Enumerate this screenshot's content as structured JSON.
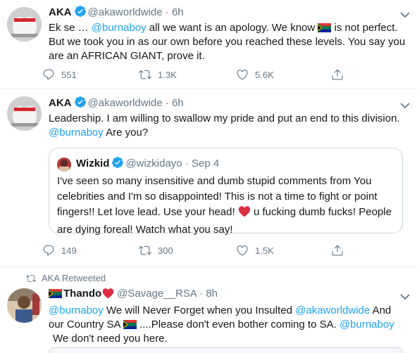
{
  "tweets": [
    {
      "name": "AKA",
      "handle": "@akaworldwide",
      "dot": "·",
      "time": "6h",
      "text_parts": [
        "Ek se … ",
        "@burnaboy",
        " all we want is an apology. We know ",
        " is not perfect.",
        "But we took you in as our own before you reached these levels. You say you",
        "are an AFRICAN GIANT, prove it."
      ],
      "replies": "551",
      "retweets": "1.3K",
      "likes": "5.6K"
    },
    {
      "name": "AKA",
      "handle": "@akaworldwide",
      "dot": "·",
      "time": "6h",
      "text_parts": [
        "Leadership. I am willing to swallow my pride and put an end to this division.",
        "@burnaboy",
        " Are you?"
      ],
      "quote": {
        "name": "Wizkid",
        "handle": "@wizkidayo",
        "dot": "·",
        "time": "Sep 4",
        "lines": [
          "I've seen so many insensitive and dumb stupid comments from You",
          "celebrities and I'm so disappointed! This is not a time to fight or point",
          "fingers!! Let love lead. Use your head! ",
          " u fucking dumb fucks! People",
          "are dying foreal! Watch what you say!"
        ]
      },
      "replies": "149",
      "retweets": "300",
      "likes": "1.5K"
    },
    {
      "retweeted_by": "AKA Retweeted",
      "name": "Thando",
      "handle": "@Savage__RSA",
      "dot": "·",
      "time": "8h",
      "text_parts": [
        "@burnaboy",
        "  We will Never Forget when you Insulted ",
        "@akaworldwide",
        "  And",
        "our Country SA ",
        " ....Please don't even bother coming to SA. ",
        "@burnaboy",
        "We don't need you here."
      ]
    }
  ],
  "icons": [
    "verified-badge-icon",
    "caret-down-icon",
    "reply-icon",
    "retweet-icon",
    "like-icon",
    "share-icon",
    "sa-flag-icon",
    "red-heart-icon"
  ],
  "colors": {
    "link": "#1da1f2",
    "text": "#14171a",
    "muted": "#657786",
    "divider": "#e6ecf0",
    "heart": "#e0245e"
  }
}
